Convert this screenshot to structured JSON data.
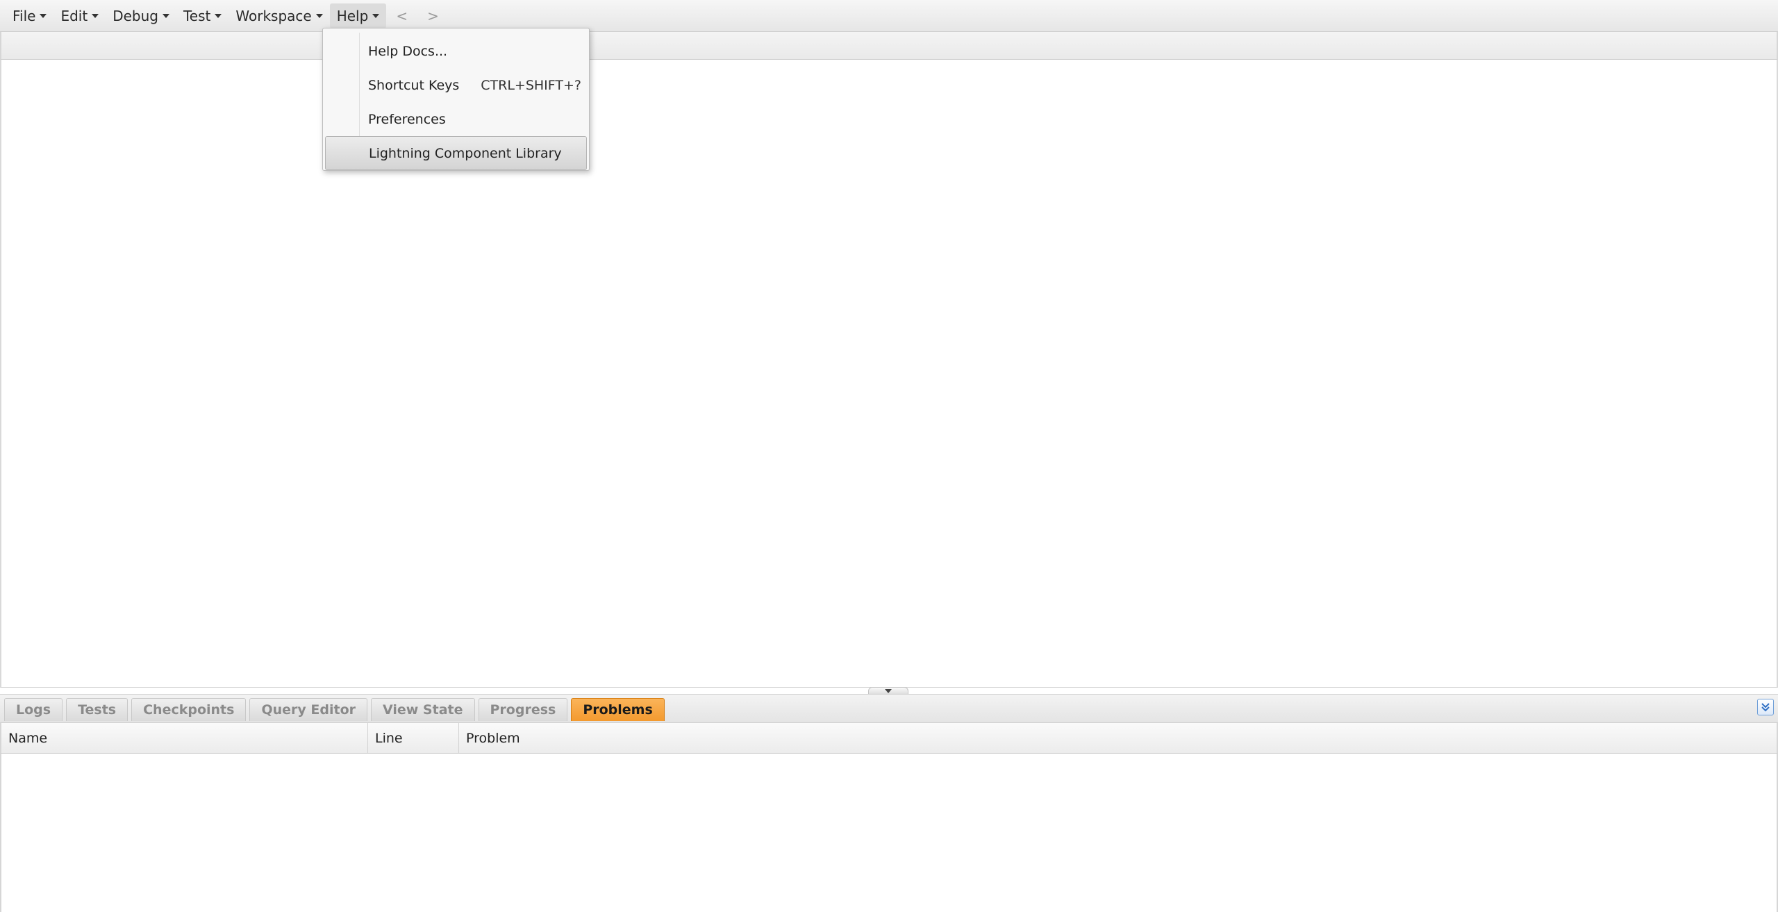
{
  "menubar": {
    "items": [
      {
        "label": "File"
      },
      {
        "label": "Edit"
      },
      {
        "label": "Debug"
      },
      {
        "label": "Test"
      },
      {
        "label": "Workspace"
      },
      {
        "label": "Help"
      }
    ],
    "back_label": "<",
    "forward_label": ">"
  },
  "help_menu": {
    "items": [
      {
        "label": "Help Docs...",
        "shortcut": ""
      },
      {
        "label": "Shortcut Keys",
        "shortcut": "CTRL+SHIFT+?"
      },
      {
        "label": "Preferences",
        "shortcut": ""
      },
      {
        "label": "Lightning Component Library",
        "shortcut": ""
      }
    ],
    "highlighted_item": "Lightning Component Library"
  },
  "bottom_panel": {
    "tabs": [
      {
        "label": "Logs"
      },
      {
        "label": "Tests"
      },
      {
        "label": "Checkpoints"
      },
      {
        "label": "Query Editor"
      },
      {
        "label": "View State"
      },
      {
        "label": "Progress"
      },
      {
        "label": "Problems"
      }
    ],
    "active_tab": "Problems",
    "toggle_icon": "collapse-panel-icon",
    "columns": [
      {
        "label": "Name"
      },
      {
        "label": "Line"
      },
      {
        "label": "Problem"
      }
    ],
    "rows": []
  },
  "colors": {
    "active_tab": "#f39a2f",
    "menu_highlight": "#d4d4d4",
    "toggle_border": "#6f9fd8"
  }
}
